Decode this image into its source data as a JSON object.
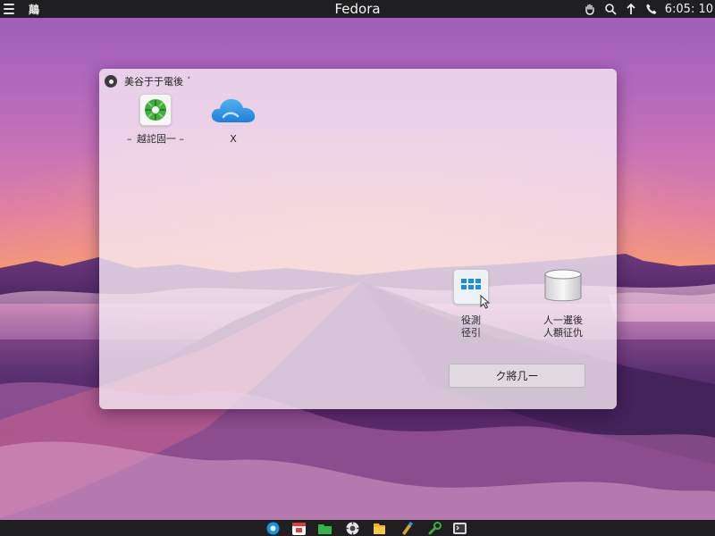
{
  "topbar": {
    "activities": "鷏",
    "title": "Fedora",
    "clock": "6:05: 10",
    "tray_icons": [
      "hand-icon",
      "search-icon",
      "up-arrow-icon",
      "phone-icon"
    ]
  },
  "window": {
    "title": "美谷于于電後",
    "caret": "˅",
    "items": [
      {
        "label": "– 越詑固一 –",
        "icon": "fedora-disk-icon"
      },
      {
        "label": "X",
        "icon": "cloud-icon"
      },
      {
        "label": "役測\n径引",
        "icon": "windows-installer-icon"
      },
      {
        "label": "人一暹後\n人頵征仇",
        "icon": "drive-icon"
      }
    ],
    "action_button": "ク將几ー"
  },
  "dock": {
    "items": [
      "browser-icon",
      "calendar-icon",
      "files-icon",
      "settings-icon",
      "folder-icon",
      "paint-icon",
      "tools-icon",
      "terminal-icon"
    ]
  },
  "colors": {
    "panel": "#1f1f22",
    "window_bg": "#f6eaf4",
    "cloud": "#2e8fe0",
    "fedora_green": "#3fae3a"
  }
}
